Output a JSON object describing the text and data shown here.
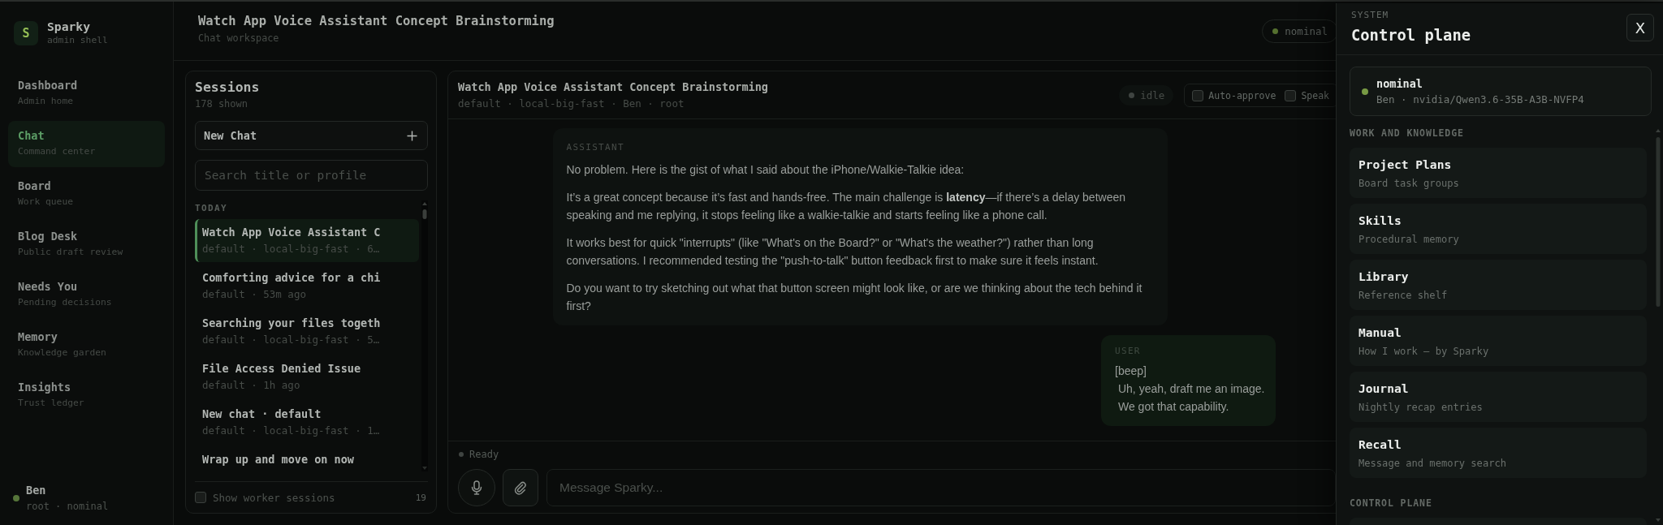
{
  "sidebar": {
    "brand": {
      "logo": "S",
      "name": "Sparky",
      "subtitle": "admin shell"
    },
    "nav": [
      {
        "label": "Dashboard",
        "description": "Admin home",
        "selected": false
      },
      {
        "label": "Chat",
        "description": "Command center",
        "selected": true
      },
      {
        "label": "Board",
        "description": "Work queue",
        "selected": false
      },
      {
        "label": "Blog Desk",
        "description": "Public draft review",
        "selected": false
      },
      {
        "label": "Needs You",
        "description": "Pending decisions",
        "selected": false
      },
      {
        "label": "Memory",
        "description": "Knowledge garden",
        "selected": false
      },
      {
        "label": "Insights",
        "description": "Trust ledger",
        "selected": false
      }
    ],
    "user": {
      "name": "Ben",
      "status": "root · nominal"
    }
  },
  "header": {
    "title": "Watch App Voice Assistant Concept Brainstorming",
    "subtitle": "Chat workspace",
    "status": "nominal"
  },
  "sessions": {
    "title": "Sessions",
    "count": "178 shown",
    "new_chat": "New Chat",
    "search": {
      "placeholder": "Search title or profile"
    },
    "group": "TODAY",
    "items": [
      {
        "title": "Watch App Voice Assistant C",
        "meta": "default · local-big-fast · 6…",
        "selected": true
      },
      {
        "title": "Comforting advice for a chi",
        "meta": "default · 53m ago",
        "selected": false
      },
      {
        "title": "Searching your files togeth",
        "meta": "default · local-big-fast · 5…",
        "selected": false
      },
      {
        "title": "File Access Denied Issue",
        "meta": "default · 1h ago",
        "selected": false
      },
      {
        "title": "New chat · default",
        "meta": "default · local-big-fast · 1…",
        "selected": false
      },
      {
        "title": "Wrap up and move on now",
        "selected": false
      }
    ],
    "show_workers": {
      "label": "Show worker sessions",
      "checked": false
    },
    "worker_count": "19"
  },
  "chat": {
    "title": "Watch App Voice Assistant Concept Brainstorming",
    "meta": "default · local-big-fast · Ben · root",
    "state": "idle",
    "toggles": [
      {
        "label": "Auto-approve",
        "checked": false
      },
      {
        "label": "Speak",
        "checked": false
      }
    ],
    "messages": [
      {
        "kind": "assistant",
        "role": "ASSISTANT",
        "paragraphs": [
          "No problem. Here is the gist of what I said about the iPhone/Walkie-Talkie idea:",
          "It’s a great concept because it’s fast and hands-free. The main challenge is **latency**—if there’s a delay between speaking and me replying, it stops feeling like a walkie-talkie and starts feeling like a phone call.",
          "It works best for quick \"interrupts\" (like \"What's on the Board?\" or \"What's the weather?\") rather than long conversations. I recommended testing the \"push-to-talk\" button feedback first to make sure it feels instant.",
          "Do you want to try sketching out what that button screen might look like, or are we thinking about the tech behind it first?"
        ]
      },
      {
        "kind": "user",
        "role": "USER",
        "paragraphs": [
          "[beep]\n Uh, yeah, draft me an image.\n We got that capability."
        ]
      }
    ],
    "status": "Ready",
    "composer": {
      "placeholder": "Message Sparky..."
    }
  },
  "control_plane": {
    "eyebrow": "SYSTEM",
    "title": "Control plane",
    "close": "X",
    "status": {
      "label": "nominal",
      "detail": "Ben · nvidia/Qwen3.6-35B-A3B-NVFP4"
    },
    "sections": [
      {
        "heading": "WORK AND KNOWLEDGE",
        "items": [
          {
            "title": "Project Plans",
            "description": "Board task groups"
          },
          {
            "title": "Skills",
            "description": "Procedural memory"
          },
          {
            "title": "Library",
            "description": "Reference shelf"
          },
          {
            "title": "Manual",
            "description": "How I work — by Sparky"
          },
          {
            "title": "Journal",
            "description": "Nightly recap entries"
          },
          {
            "title": "Recall",
            "description": "Message and memory search"
          }
        ]
      },
      {
        "heading": "CONTROL PLANE"
      }
    ]
  }
}
